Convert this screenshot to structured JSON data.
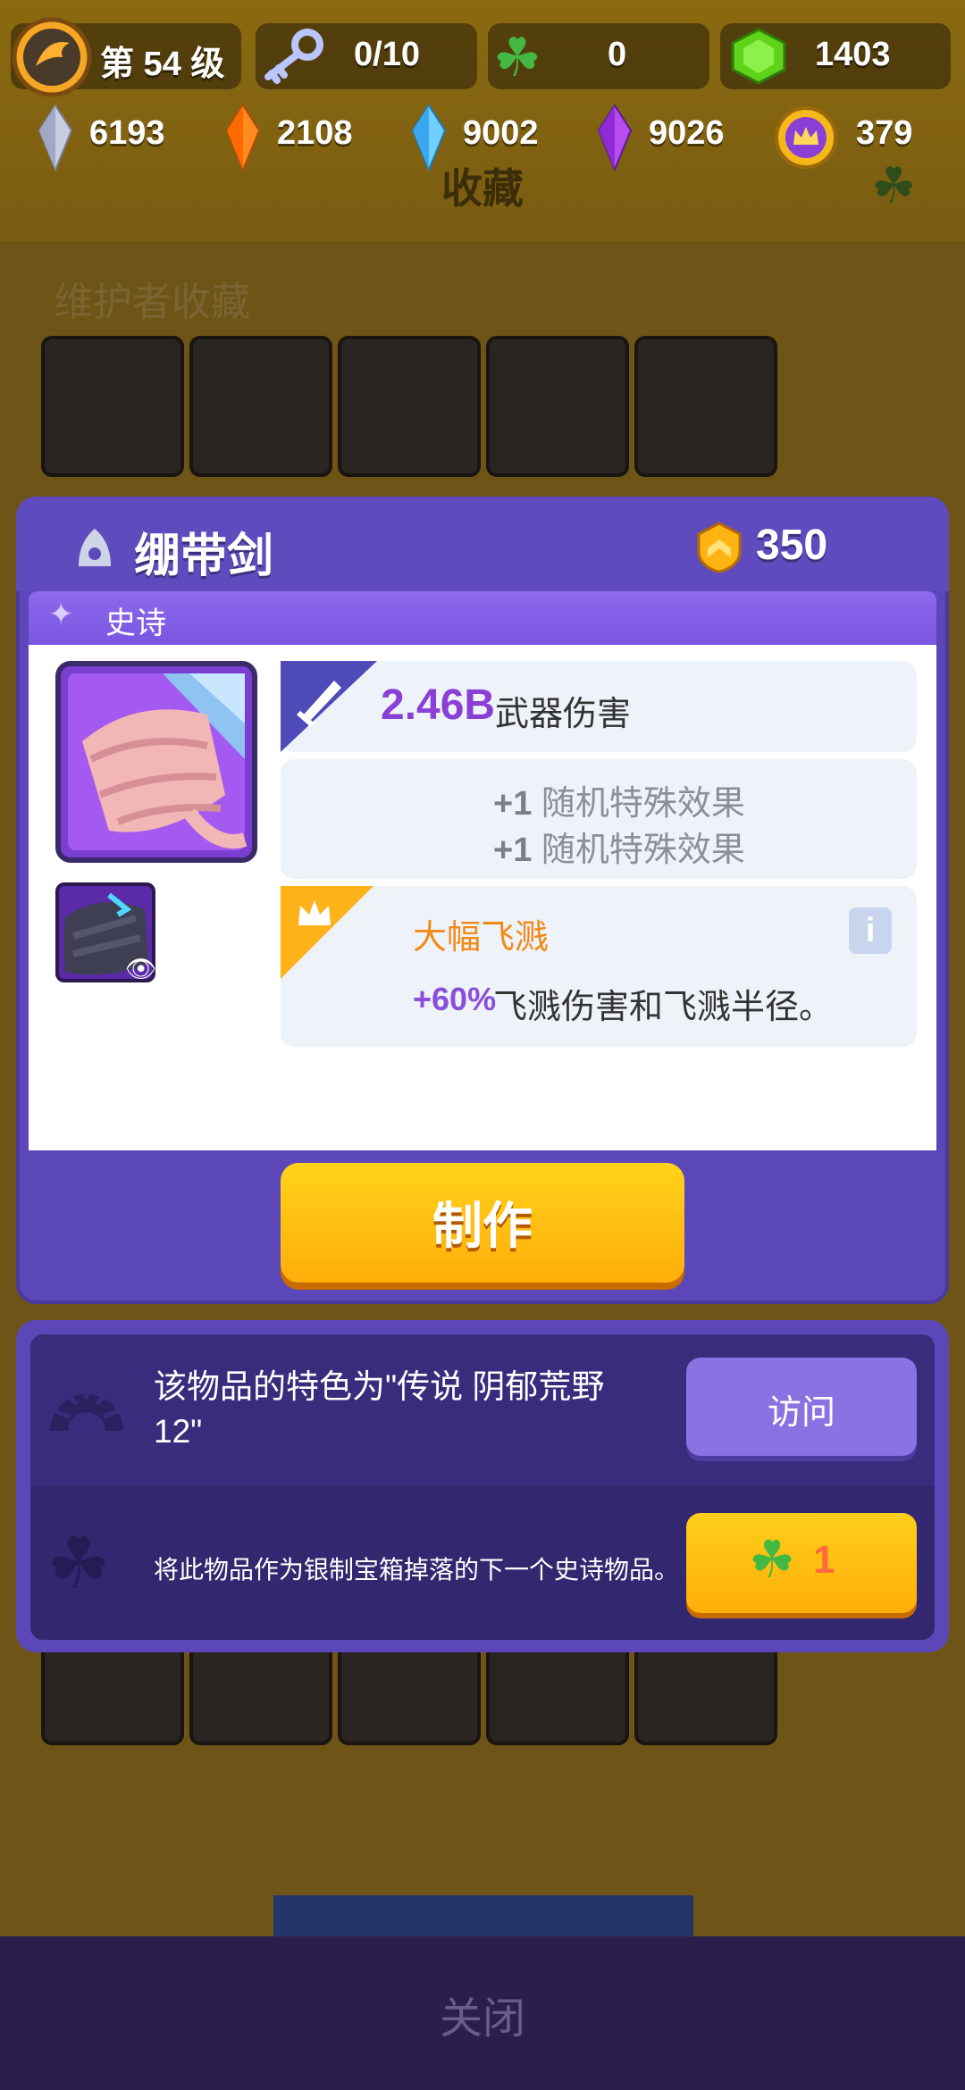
{
  "resources": {
    "level": "第 54 级",
    "keys": "0/10",
    "clovers": "0",
    "green_gems": "1403",
    "silver_crystals": "6193",
    "orange_crystals": "2108",
    "blue_crystals": "9002",
    "purple_crystals": "9026",
    "crowns": "379"
  },
  "background": {
    "title": "收藏",
    "section": "维护者收藏",
    "close": "关闭"
  },
  "item": {
    "name": "绷带剑",
    "power": "350",
    "rarity": "史诗",
    "stat_value": "2.46B",
    "stat_label": "武器伤害",
    "effect_1_prefix": "+1",
    "effect_1_text": "随机特殊效果",
    "effect_2_prefix": "+1",
    "effect_2_text": "随机特殊效果",
    "perk_name": "大幅飞溅",
    "perk_percent": "+60%",
    "perk_desc": "飞溅伤害和飞溅半径。",
    "craft_label": "制作"
  },
  "info": {
    "feature_text": "该物品的特色为\"传说 阴郁荒野 12\"",
    "visit_label": "访问",
    "drop_text": "将此物品作为银制宝箱掉落的下一个史诗物品。",
    "clover_cost": "1"
  },
  "colors": {
    "dialog": "#5c47b8",
    "rarity_bar": "#8e69ee",
    "craft_button": "#ffb80f",
    "stat_value": "#8a3fd6",
    "perk_name": "#f28a18"
  }
}
